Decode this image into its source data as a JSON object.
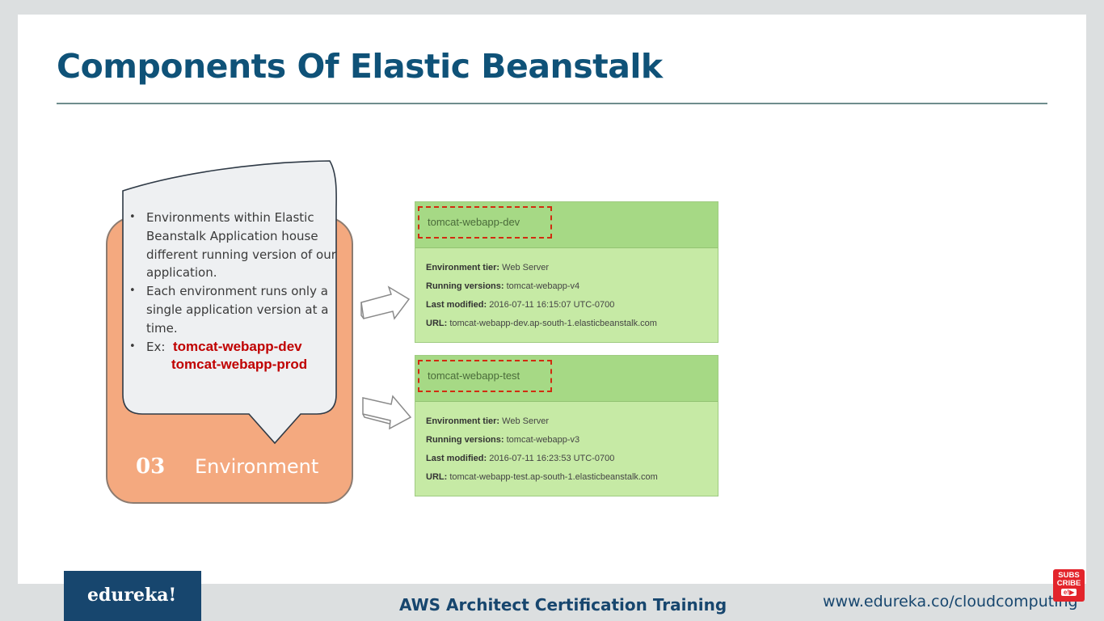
{
  "slide": {
    "title": "Components Of Elastic Beanstalk"
  },
  "component": {
    "number": "03",
    "name": "Environment",
    "bullets": [
      "Environments within Elastic Beanstalk Application house different running version of our application.",
      "Each environment runs only a single application version at a time."
    ],
    "example_prefix": "Ex:",
    "examples": [
      "tomcat-webapp-dev",
      "tomcat-webapp-prod"
    ],
    "bullet_char": "•"
  },
  "environments": [
    {
      "name": "tomcat-webapp-dev",
      "rows": [
        {
          "key": "Environment tier:",
          "value": "Web Server"
        },
        {
          "key": "Running versions:",
          "value": "tomcat-webapp-v4"
        },
        {
          "key": "Last modified:",
          "value": "2016-07-11 16:15:07 UTC-0700"
        },
        {
          "key": "URL:",
          "value": "tomcat-webapp-dev.ap-south-1.elasticbeanstalk.com"
        }
      ]
    },
    {
      "name": "tomcat-webapp-test",
      "rows": [
        {
          "key": "Environment tier:",
          "value": "Web Server"
        },
        {
          "key": "Running versions:",
          "value": "tomcat-webapp-v3"
        },
        {
          "key": "Last modified:",
          "value": "2016-07-11 16:23:53 UTC-0700"
        },
        {
          "key": "URL:",
          "value": "tomcat-webapp-test.ap-south-1.elasticbeanstalk.com"
        }
      ]
    }
  ],
  "footer": {
    "logo": "edureka!",
    "course": "AWS Architect Certification Training",
    "website": "www.edureka.co/cloudcomputing",
    "subscribe_line1": "SUBS",
    "subscribe_line2": "CRIBE",
    "subscribe_badge": "e!▶"
  },
  "colors": {
    "title": "#0f5278",
    "component_card": "#f4a97f",
    "env_panel": "#c6eaa5",
    "env_header": "#a6d985",
    "highlight_dash": "#d12c10",
    "example_text": "#c00000",
    "brand": "#17466e"
  }
}
